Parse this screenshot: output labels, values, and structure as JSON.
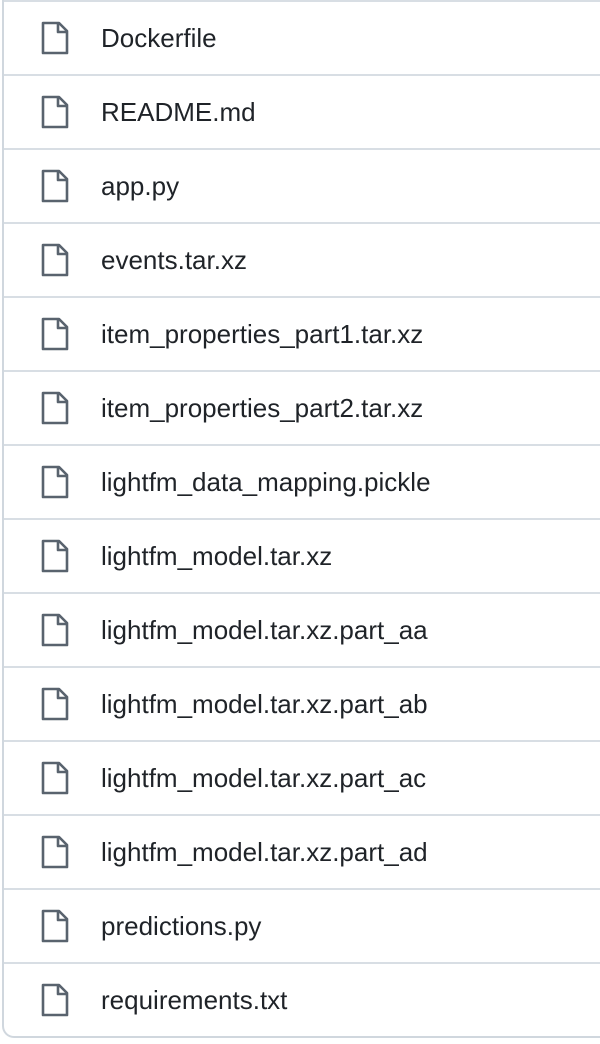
{
  "files": [
    {
      "name": "Dockerfile",
      "icon": "file-icon"
    },
    {
      "name": "README.md",
      "icon": "file-icon"
    },
    {
      "name": "app.py",
      "icon": "file-icon"
    },
    {
      "name": "events.tar.xz",
      "icon": "file-icon"
    },
    {
      "name": "item_properties_part1.tar.xz",
      "icon": "file-icon"
    },
    {
      "name": "item_properties_part2.tar.xz",
      "icon": "file-icon"
    },
    {
      "name": "lightfm_data_mapping.pickle",
      "icon": "file-icon"
    },
    {
      "name": "lightfm_model.tar.xz",
      "icon": "file-icon"
    },
    {
      "name": "lightfm_model.tar.xz.part_aa",
      "icon": "file-icon"
    },
    {
      "name": "lightfm_model.tar.xz.part_ab",
      "icon": "file-icon"
    },
    {
      "name": "lightfm_model.tar.xz.part_ac",
      "icon": "file-icon"
    },
    {
      "name": "lightfm_model.tar.xz.part_ad",
      "icon": "file-icon"
    },
    {
      "name": "predictions.py",
      "icon": "file-icon"
    },
    {
      "name": "requirements.txt",
      "icon": "file-icon"
    }
  ],
  "colors": {
    "text": "#1f2328",
    "icon": "#59636e",
    "border": "#d0d7de"
  }
}
